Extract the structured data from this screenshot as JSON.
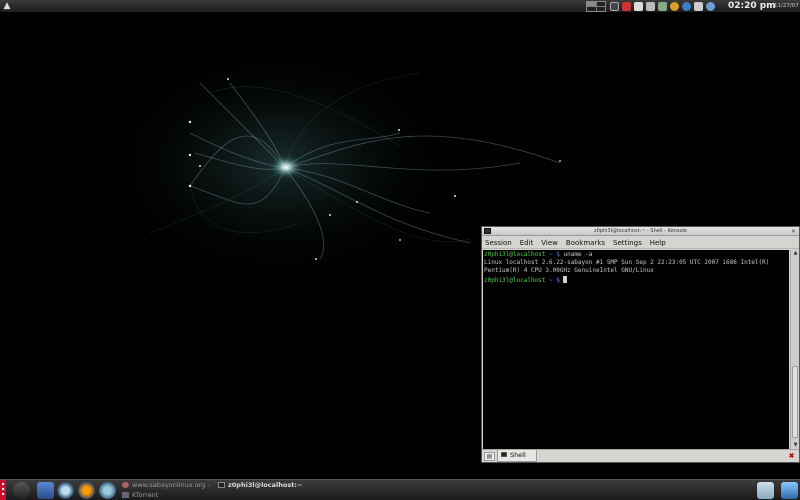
{
  "top_panel": {
    "menu_icon": "arrow-icon",
    "tray_icons": [
      "display-icon",
      "mail-icon",
      "clipboard-icon",
      "pen-icon",
      "network-icon",
      "updater-icon",
      "globe-icon",
      "speaker-icon",
      "info-icon"
    ],
    "clock_time": "02:20 pm",
    "clock_date": "11/27/07"
  },
  "konsole": {
    "title": "z0phi3l@localhost:~ - Shell - Konsole",
    "menu": [
      "Session",
      "Edit",
      "View",
      "Bookmarks",
      "Settings",
      "Help"
    ],
    "terminal": {
      "prompt1_user": "z0phi3l@localhost",
      "prompt1_path": " ~ $ ",
      "command": "uname -a",
      "output_line1": "Linux localhost 2.6.22-sabayon #1 SMP Sun Sep 2 22:23:05 UTC 2007 i686 Intel(R)",
      "output_line2": "Pentium(R) 4 CPU 3.00GHz GenuineIntel GNU/Linux",
      "prompt2_user": "z0phi3l@localhost",
      "prompt2_path": " ~ $ "
    },
    "tab_label": "Shell"
  },
  "taskbar": {
    "items": [
      {
        "label": "www.sabayonlinux.org -"
      },
      {
        "label": "KTorrent"
      },
      {
        "label": "z0phi3l@localhost:~"
      }
    ]
  },
  "colors": {
    "terminal_bg": "#000000",
    "prompt_green": "#4fd04f",
    "prompt_blue": "#5577ff",
    "kmenu_red": "#c8102e"
  }
}
